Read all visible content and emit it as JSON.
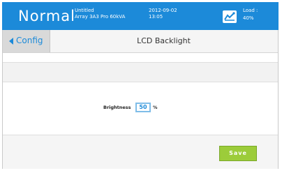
{
  "header": {
    "status": "Normal",
    "project_name": "Untitled",
    "array_name": "Array 3A3 Pro 60kVA",
    "date": "2012-09-02",
    "time": "13:05",
    "load_label": "Load :",
    "load_value": "40%",
    "load_icon": "load-gauge-icon"
  },
  "nav": {
    "back_label": "Config",
    "title": "LCD Backlight"
  },
  "form": {
    "brightness_label": "Brightness",
    "brightness_value": "50",
    "brightness_unit": "%"
  },
  "footer": {
    "save_label": "Save"
  },
  "colors": {
    "header_blue": "#1c8ad9",
    "save_green": "#9ccc3a"
  }
}
